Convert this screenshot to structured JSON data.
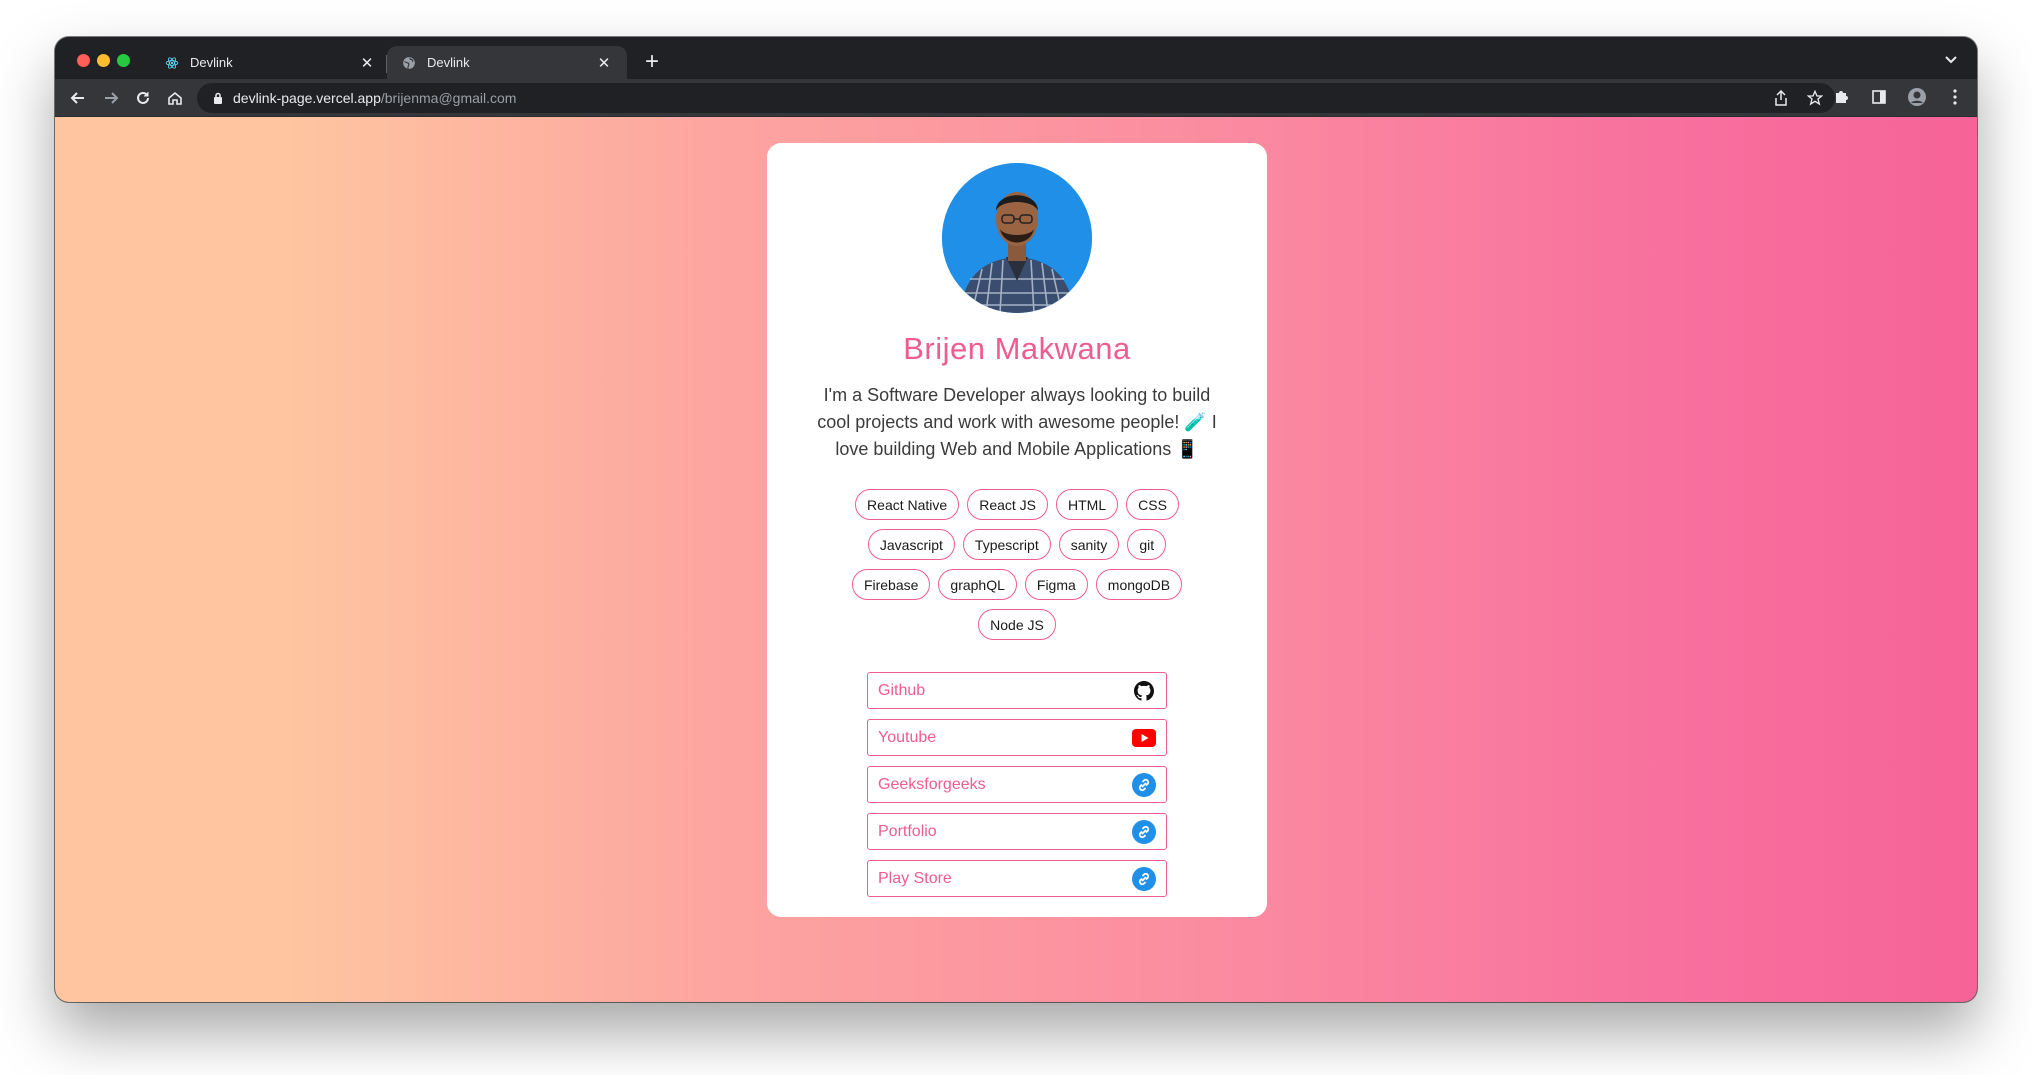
{
  "browser": {
    "tabs": [
      {
        "title": "Devlink",
        "favicon": "react-icon",
        "active": false
      },
      {
        "title": "Devlink",
        "favicon": "globe-icon",
        "active": true
      }
    ],
    "url_host": "devlink-page.vercel.app",
    "url_path": "/brijenma@gmail.com"
  },
  "profile": {
    "name": "Brijen Makwana",
    "bio": "I'm a Software Developer always looking to build cool projects and work with awesome people! 🧪 I love building Web and Mobile Applications 📱",
    "skills": [
      "React Native",
      "React JS",
      "HTML",
      "CSS",
      "Javascript",
      "Typescript",
      "sanity",
      "git",
      "Firebase",
      "graphQL",
      "Figma",
      "mongoDB",
      "Node JS"
    ],
    "links": [
      {
        "label": "Github",
        "icon": "github-icon"
      },
      {
        "label": "Youtube",
        "icon": "youtube-icon"
      },
      {
        "label": "Geeksforgeeks",
        "icon": "link-icon"
      },
      {
        "label": "Portfolio",
        "icon": "link-icon"
      },
      {
        "label": "Play Store",
        "icon": "link-icon"
      }
    ]
  },
  "colors": {
    "accent": "#ee5d8f",
    "gradient_start": "#fec5a0",
    "gradient_end": "#f66397",
    "link_icon_blue": "#1f8fe8",
    "youtube_red": "#ff0000"
  }
}
